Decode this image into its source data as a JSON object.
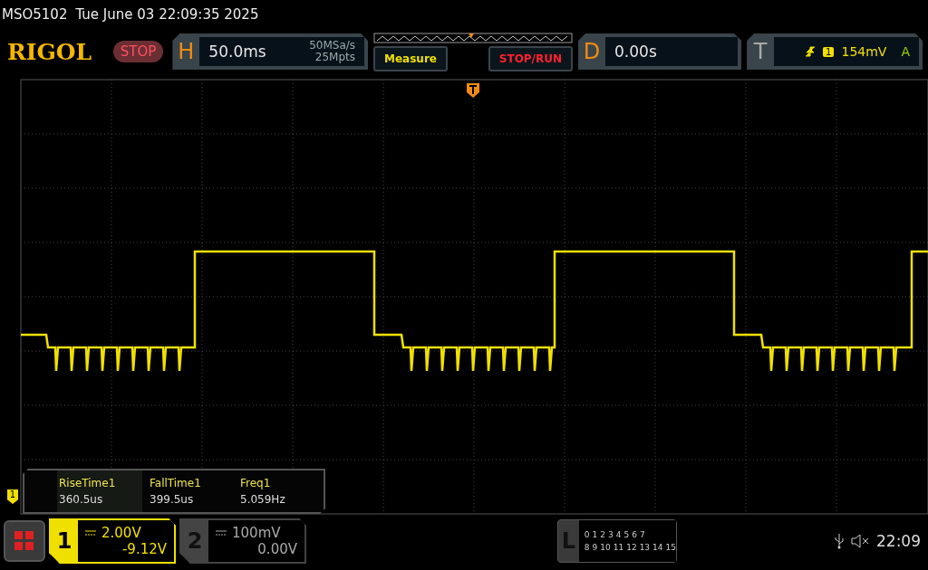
{
  "title_bar": {
    "model": "MSO5102",
    "datetime": "Tue June 03 22:09:35 2025"
  },
  "header": {
    "logo": "RIGOL",
    "run_state": "STOP",
    "horizontal": {
      "label": "H",
      "timebase": "50.0ms",
      "sample_rate": "50MSa/s",
      "memory_depth": "25Mpts"
    },
    "measure_button": "Measure",
    "stop_run_button": "STOP/RUN",
    "delay": {
      "label": "D",
      "value": "0.00s"
    },
    "trigger": {
      "label": "T",
      "source": "1",
      "level": "154mV",
      "mode": "A"
    }
  },
  "display": {
    "channel_marker": "1",
    "measurements": [
      {
        "name": "RiseTime1",
        "value": "360.5us"
      },
      {
        "name": "FallTime1",
        "value": "399.5us"
      },
      {
        "name": "Freq1",
        "value": "5.059Hz"
      }
    ]
  },
  "channels": [
    {
      "number": "1",
      "scale": "2.00V",
      "offset": "-9.12V",
      "selected": true
    },
    {
      "number": "2",
      "scale": "100mV",
      "offset": "0.00V",
      "selected": false
    }
  ],
  "logic": {
    "label": "L",
    "row_1": [
      "0",
      "1",
      "2",
      "3",
      "4",
      "5",
      "6",
      "7"
    ],
    "row_2": [
      "8",
      "9",
      "10",
      "11",
      "12",
      "13",
      "14",
      "15"
    ]
  },
  "status": {
    "time": "22:09"
  }
}
